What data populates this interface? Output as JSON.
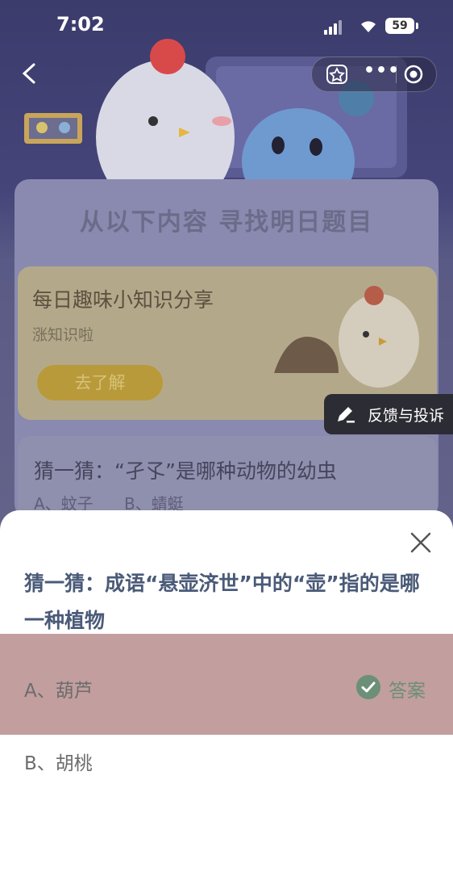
{
  "status_bar": {
    "time": "7:02",
    "battery": "59"
  },
  "header": {
    "more": "•••"
  },
  "page": {
    "section_title": "从以下内容  寻找明日题目",
    "fact_card": {
      "title": "每日趣味小知识分享",
      "subtitle": "涨知识啦",
      "button": "去了解"
    },
    "feedback": {
      "label": "反馈与投诉"
    },
    "quiz_card": {
      "title": "猜一猜：“孑孓”是哪种动物的幼虫",
      "option_a": "A、蚊子",
      "option_b": "B、蜻蜓"
    }
  },
  "sheet": {
    "question": "猜一猜：成语“悬壶济世”中的“壶”指的是哪一种植物",
    "options": [
      {
        "label": "A、葫芦",
        "is_answer": true
      },
      {
        "label": "B、胡桃",
        "is_answer": false
      }
    ],
    "answer_label": "答案"
  },
  "colors": {
    "highlight": "#c29e9e",
    "answer": "#6c8f78",
    "question_text": "#4a5a78"
  }
}
